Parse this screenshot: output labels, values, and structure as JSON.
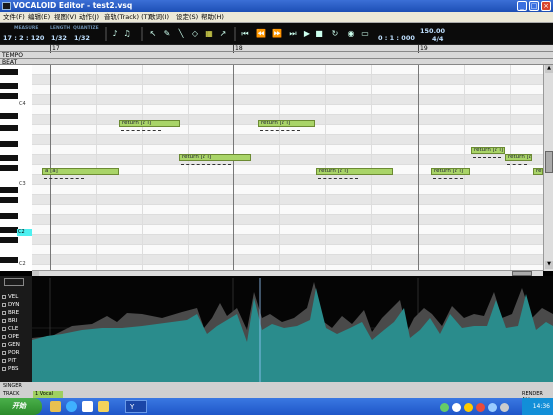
{
  "window": {
    "title": "VOCALOID Editor - test2.vsq",
    "min": "_",
    "max": "□",
    "close": "×"
  },
  "menu": [
    "文件(F)",
    "编辑(E)",
    "视图(V)",
    "动作(J)",
    "音轨(Track) (T)",
    "歌词(I)",
    "设定(S)",
    "帮助(H)"
  ],
  "toolbar": {
    "measure_label": "MEASURE",
    "measure_value": "17 : 2 : 120",
    "length_label": "LENGTH",
    "length_value": "1/32",
    "quantize_label": "QUANTIZE",
    "quantize_value": "1/32",
    "time_value": "0 : 1 : 000",
    "tempo_value": "150.00",
    "beat_value": "4/4"
  },
  "ruler": {
    "tempo_label": "TEMPO",
    "beat_label": "BEAT",
    "measures": [
      "17",
      "18",
      "19"
    ]
  },
  "keys": {
    "labels": [
      "C4",
      "C3",
      "C2"
    ],
    "highlight": "C2"
  },
  "notes": [
    {
      "text": "return [ɾ i]"
    },
    {
      "text": "return [ɾ i]"
    },
    {
      "text": "return [ɾ i]"
    },
    {
      "text": "a [a]"
    },
    {
      "text": "return [ɾ i]"
    },
    {
      "text": "return [ɾ i]"
    },
    {
      "text": "return [ɾ i]"
    },
    {
      "text": "return [ɾ i]"
    },
    {
      "text": "return [ɾ i]"
    }
  ],
  "controls": [
    "VEL",
    "DYN",
    "BRE",
    "BRI",
    "CLE",
    "OPE",
    "GEN",
    "POR",
    "PIT",
    "PBS"
  ],
  "bottom": {
    "singer_label": "SINGER",
    "track_label": "TRACK",
    "render_label": "RENDER ALL",
    "track_tab": "1 Vocal"
  },
  "taskbar": {
    "start": "开始",
    "window_label": "Y",
    "clock": "14:36"
  },
  "colors": {
    "note_fill": "#a9d468",
    "graph_teal": "#2a8c8c",
    "graph_gray": "#4a4a4a",
    "title_blue": "#1d4fb5"
  }
}
